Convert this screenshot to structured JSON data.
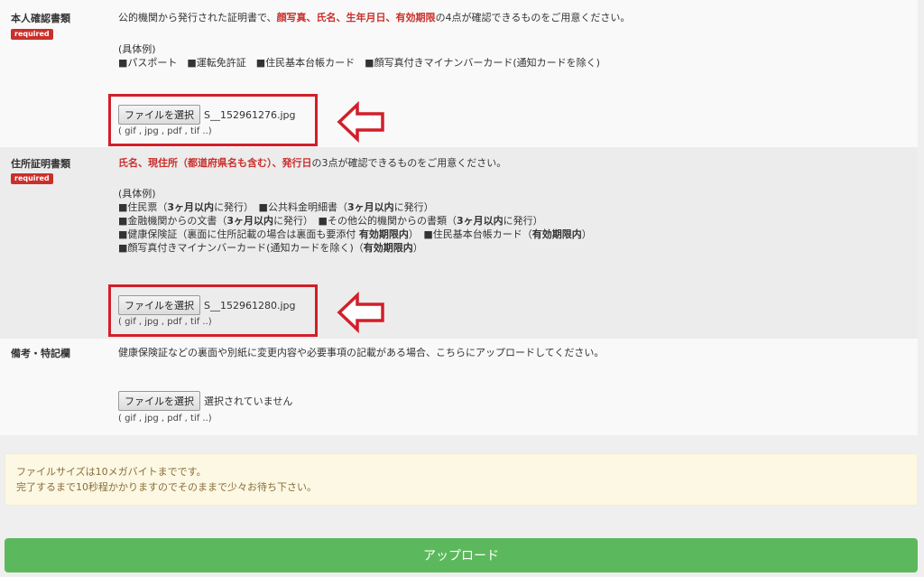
{
  "section1": {
    "label": "本人確認書類",
    "badge": "required",
    "intro_pre": "公的機関から発行された証明書で、",
    "intro_red": "顔写真、氏名、生年月日、有効期限",
    "intro_post": "の4点が確認できるものをご用意ください。",
    "examples_title": "(具体例)",
    "examples": "■パスポート　■運転免許証　■住民基本台帳カード　■顔写真付きマイナンバーカード(通知カードを除く)",
    "file_button": "ファイルを選択",
    "file_name": "S__152961276.jpg",
    "ext": "( gif , jpg , pdf , tif ..)"
  },
  "section2": {
    "label": "住所証明書類",
    "badge": "required",
    "intro_red": "氏名、現住所（都道府県名も含む）、発行日",
    "intro_post": "の3点が確認できるものをご用意ください。",
    "examples_title": "(具体例)",
    "ex1a": "■住民票（",
    "ex1b": "3ヶ月以内",
    "ex1c": "に発行）　■公共料金明細書（",
    "ex1d": "3ヶ月以内",
    "ex1e": "に発行）",
    "ex2a": "■金融機関からの文書（",
    "ex2b": "3ヶ月以内",
    "ex2c": "に発行）　■その他公的機関からの書類（",
    "ex2d": "3ヶ月以内",
    "ex2e": "に発行）",
    "ex3a": "■健康保険証（裏面に住所記載の場合は裏面も要添付 ",
    "ex3b": "有効期限内",
    "ex3c": "）　■住民基本台帳カード（",
    "ex3d": "有効期限内",
    "ex3e": "）",
    "ex4a": "■顔写真付きマイナンバーカード(通知カードを除く)（",
    "ex4b": "有効期限内",
    "ex4c": "）",
    "file_button": "ファイルを選択",
    "file_name": "S__152961280.jpg",
    "ext": "( gif , jpg , pdf , tif ..)"
  },
  "section3": {
    "label": "備考・特記欄",
    "intro": "健康保険証などの裏面や別紙に変更内容や必要事項の記載がある場合、こちらにアップロードしてください。",
    "file_button": "ファイルを選択",
    "file_name": "選択されていません",
    "ext": "( gif , jpg , pdf , tif ..)"
  },
  "notice": {
    "line1": "ファイルサイズは10メガバイトまでです。",
    "line2": "完了するまで10秒程かかりますのでそのままで少々お待ち下さい。"
  },
  "upload_button": "アップロード",
  "colors": {
    "required": "#c9302c",
    "highlight": "#d11f2a",
    "upload": "#5cb85c",
    "notice_bg": "#fcf8e3"
  }
}
